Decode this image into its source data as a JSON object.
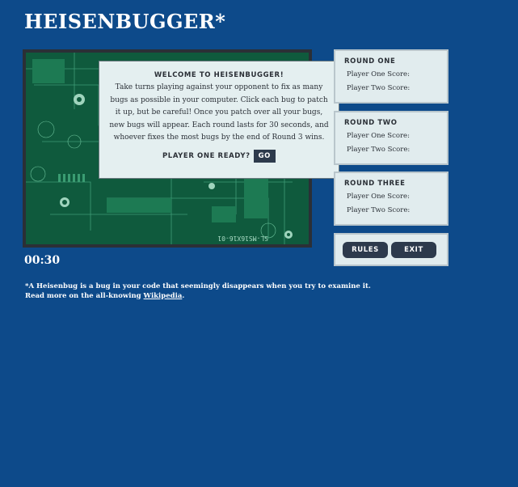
{
  "title": "HEISENBUGGER*",
  "modal": {
    "heading": "WELCOME TO HEISENBUGGER!",
    "body": "Take turns playing against your opponent to fix as many bugs as possible in your computer. Click each bug to patch it up, but be careful! Once you patch over all your bugs, new bugs will appear. Each round lasts for 30 seconds, and whoever fixes the most bugs by the end of Round 3 wins.",
    "ready_label": "PLAYER ONE READY?",
    "go_label": "GO"
  },
  "timer": "00:30",
  "footnote": {
    "line1": "*A Heisenbug is a bug in your code that seemingly disappears when you try to examine it.",
    "line2_prefix": "Read more on the all-knowing ",
    "link_text": "Wikipedia",
    "line2_suffix": "."
  },
  "rounds": [
    {
      "title": "ROUND ONE",
      "p1": "Player One Score:",
      "p2": "Player Two Score:"
    },
    {
      "title": "ROUND TWO",
      "p1": "Player One Score:",
      "p2": "Player Two Score:"
    },
    {
      "title": "ROUND THREE",
      "p1": "Player One Score:",
      "p2": "Player Two Score:"
    }
  ],
  "controls": {
    "rules_label": "RULES",
    "exit_label": "EXIT"
  },
  "board_text": "SL-MS16X16-01",
  "colors": {
    "background": "#0d4a8a",
    "panel": "#e1ecee",
    "button": "#2d3a4c",
    "pcb": "#0e5b3c"
  }
}
